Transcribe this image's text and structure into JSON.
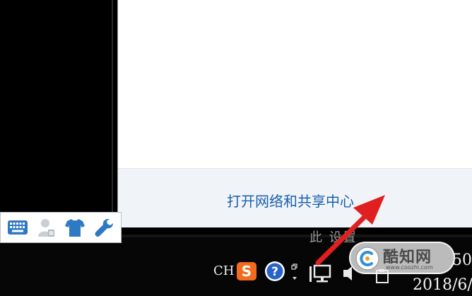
{
  "network_popup": {
    "link_label": "打开网络和共享中心"
  },
  "background": {
    "partial_text": "此 设置"
  },
  "ime_toolbar": {
    "buttons": [
      {
        "name": "keyboard-icon"
      },
      {
        "name": "user-icon"
      },
      {
        "name": "skin-shirt-icon"
      },
      {
        "name": "wrench-icon"
      }
    ]
  },
  "taskbar": {
    "language": "CH",
    "tray_icons": [
      {
        "name": "sogou-input-icon",
        "glyph": "S"
      },
      {
        "name": "help-icon",
        "glyph": "?"
      },
      {
        "name": "show-hidden-icons-icon"
      },
      {
        "name": "network-monitor-icon"
      },
      {
        "name": "speaker-icon"
      },
      {
        "name": "notification-icon"
      }
    ],
    "clock": {
      "time": "50",
      "date": "2018/6/"
    }
  },
  "watermark": {
    "title": "酷知网",
    "url": "www.coozhi.com"
  },
  "colors": {
    "link": "#1a5faa",
    "popup_footer": "#f0f4f9",
    "taskbar": "#060606",
    "arrow": "#e02020",
    "sogou": "#f36b1c",
    "help": "#2a63c8"
  }
}
